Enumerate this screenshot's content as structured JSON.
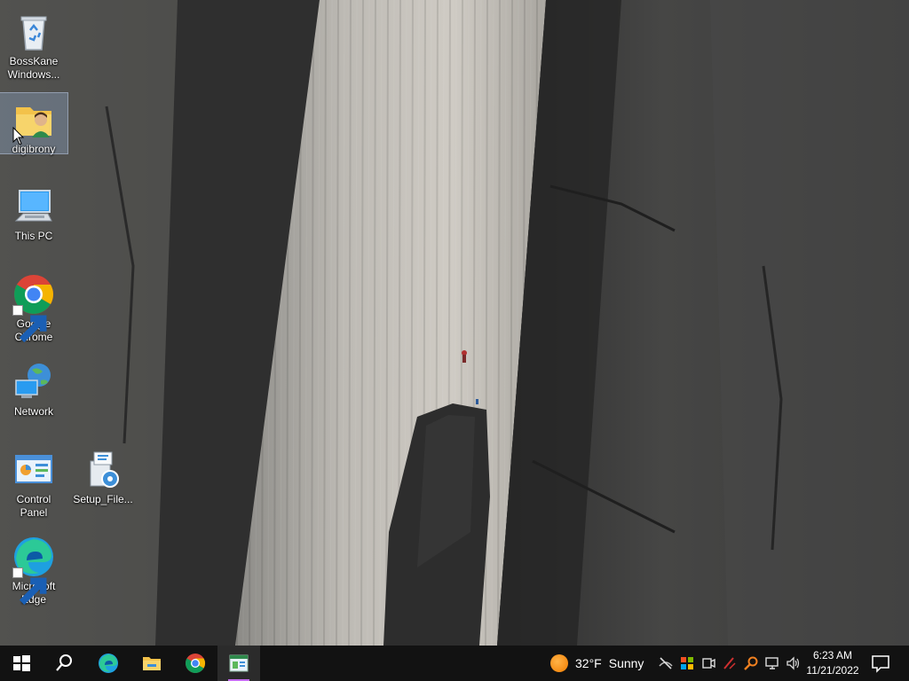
{
  "desktop": {
    "icons": [
      {
        "label": "BossKane Windows...",
        "icon": "recycle-bin-icon"
      },
      {
        "label": "digibrony",
        "icon": "user-folder-icon",
        "selected": true
      },
      {
        "label": "This PC",
        "icon": "computer-icon"
      },
      {
        "label": "Google Chrome",
        "icon": "chrome-icon",
        "shortcut": true
      },
      {
        "label": "Network",
        "icon": "network-globe-icon"
      },
      {
        "label": "Control Panel",
        "icon": "control-panel-icon"
      },
      {
        "label": "Setup_File...",
        "icon": "installer-icon"
      },
      {
        "label": "Microsoft Edge",
        "icon": "edge-icon",
        "shortcut": true
      }
    ]
  },
  "taskbar": {
    "pinned": [
      "start-icon",
      "search-icon",
      "edge-icon",
      "file-explorer-icon",
      "chrome-icon",
      "app-window-icon"
    ],
    "active_app": "app-window-icon",
    "weather": {
      "temp": "32°F",
      "condition": "Sunny"
    },
    "tray_icons": [
      "network-slash-icon",
      "security-shield-icon",
      "meet-now-icon",
      "pen-icon",
      "search-key-icon",
      "network-icon",
      "volume-icon"
    ],
    "clock": {
      "time": "6:23 AM",
      "date": "11/21/2022"
    },
    "colors": {
      "background": "#121212",
      "active_indicator": "#c56cf0"
    }
  }
}
